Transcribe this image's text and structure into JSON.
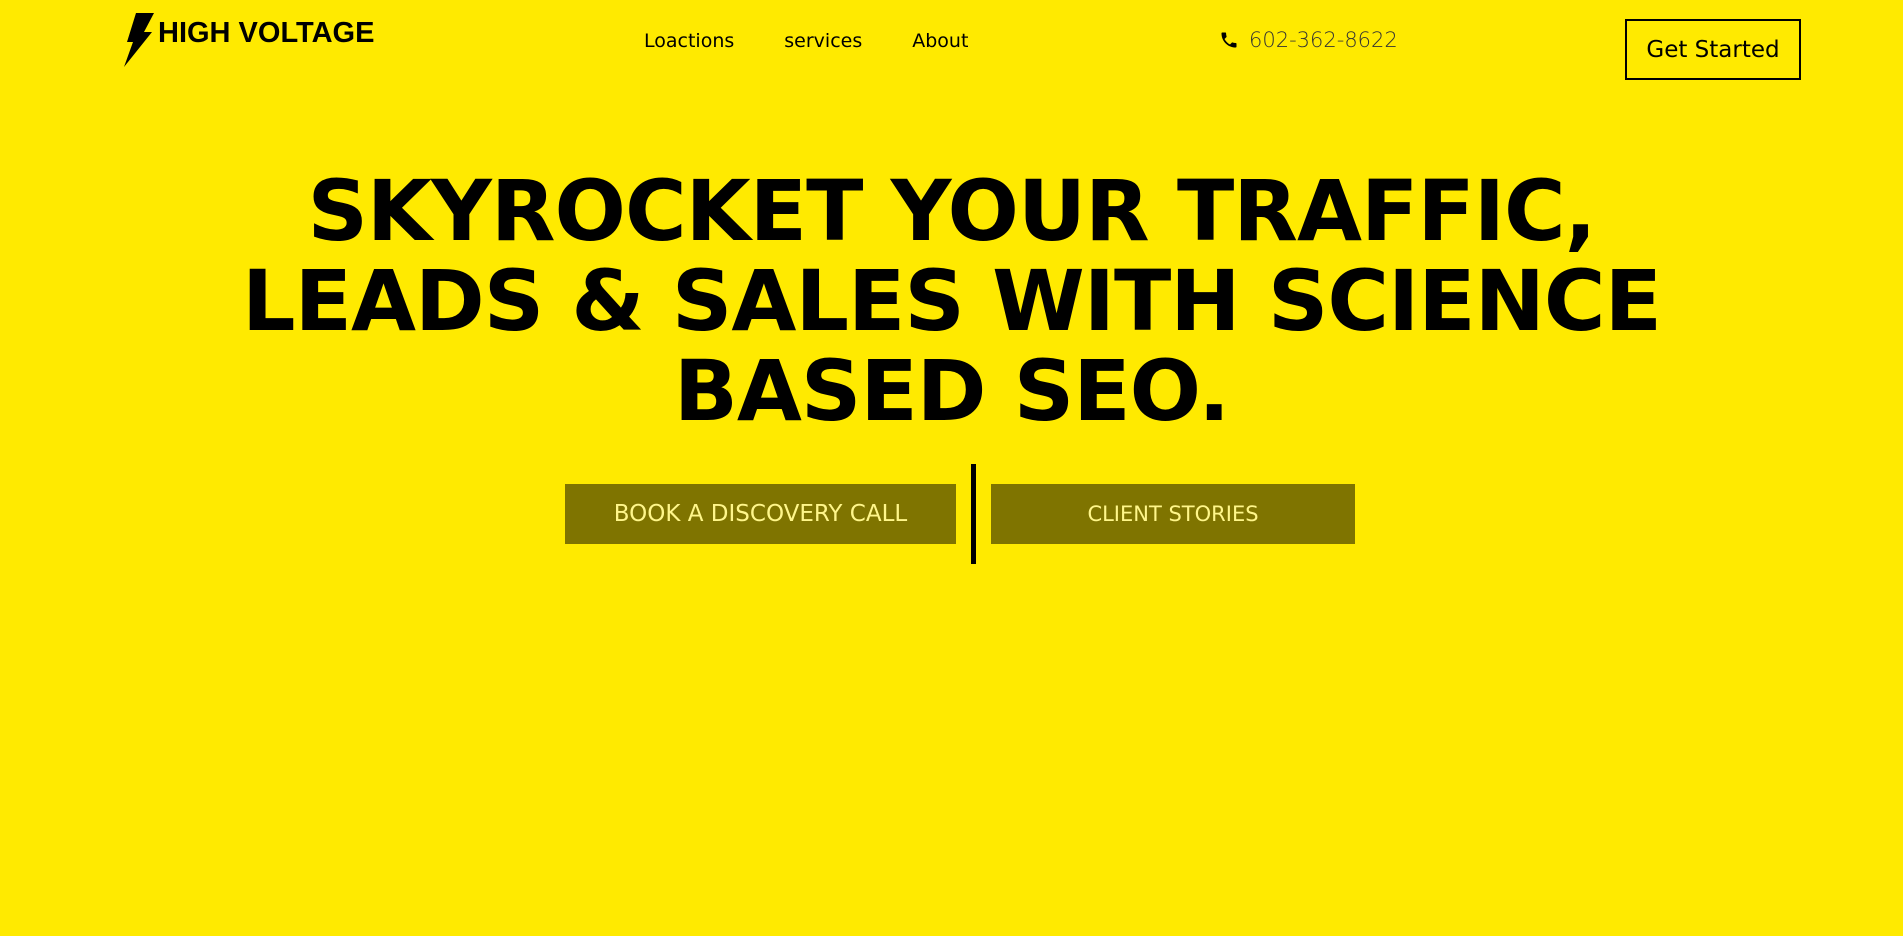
{
  "header": {
    "logo_text": "HIGH VOLTAGE",
    "logo_icon": "lightning-bolt-icon",
    "nav": [
      {
        "label": "Loactions"
      },
      {
        "label": "services"
      },
      {
        "label": "About"
      }
    ],
    "phone": {
      "icon": "phone-icon",
      "number": "602-362-8622"
    },
    "cta_label": "Get Started"
  },
  "hero": {
    "title_lines": [
      "SKYROCKET YOUR TRAFFIC,",
      "LEADS & SALES WITH SCIENCE",
      "BASED SEO."
    ],
    "primary_button": "BOOK A DISCOVERY CALL",
    "secondary_button": "CLIENT STORIES"
  },
  "colors": {
    "background": "#ffea00",
    "button_bg": "#7f7400",
    "button_text": "#fff68a",
    "text": "#000000"
  }
}
